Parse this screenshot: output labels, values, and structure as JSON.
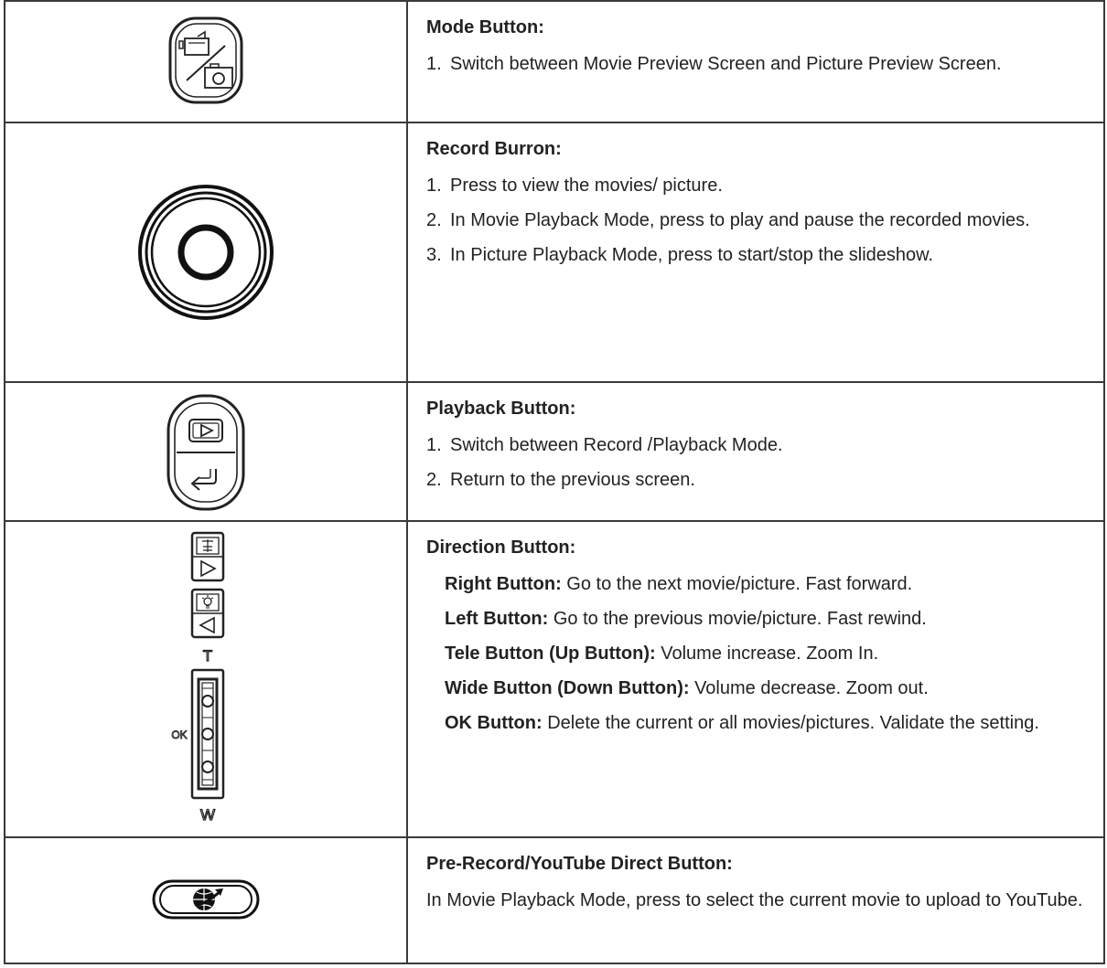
{
  "rows": [
    {
      "icon": "mode-switch-icon",
      "title": "Mode Button:",
      "items": [
        {
          "num": "1.",
          "text": "Switch between Movie Preview Screen and Picture Preview Screen."
        }
      ]
    },
    {
      "icon": "record-button-icon",
      "title": "Record Burron:",
      "items": [
        {
          "num": "1.",
          "text": "Press to view the movies/ picture."
        },
        {
          "num": "2.",
          "text": "In Movie Playback Mode, press to play and pause the recorded movies."
        },
        {
          "num": "3.",
          "text": "In Picture Playback Mode, press to start/stop the slideshow."
        }
      ]
    },
    {
      "icon": "playback-button-icon",
      "title": "Playback Button:",
      "items": [
        {
          "num": "1.",
          "text": "Switch between Record /Playback Mode."
        },
        {
          "num": "2.",
          "text": "Return to the previous screen."
        }
      ]
    },
    {
      "icon": "direction-buttons-icon",
      "title": "Direction Button:",
      "labels": {
        "t": "T",
        "ok": "OK",
        "w": "W"
      },
      "subs": [
        {
          "label": "Right Button:",
          "text": " Go to the next movie/picture. Fast forward."
        },
        {
          "label": "Left Button:",
          "text": " Go to the previous movie/picture. Fast rewind."
        },
        {
          "label": "Tele Button (Up Button):",
          "text": " Volume increase. Zoom In."
        },
        {
          "label": "Wide Button (Down Button):",
          "text": " Volume decrease. Zoom out."
        },
        {
          "label": "OK Button:",
          "text": " Delete the current or all movies/pictures. Validate the setting."
        }
      ]
    },
    {
      "icon": "youtube-globe-icon",
      "title": "Pre-Record/YouTube Direct Button:",
      "text": "In Movie Playback Mode, press to select the current movie to upload to YouTube."
    }
  ]
}
